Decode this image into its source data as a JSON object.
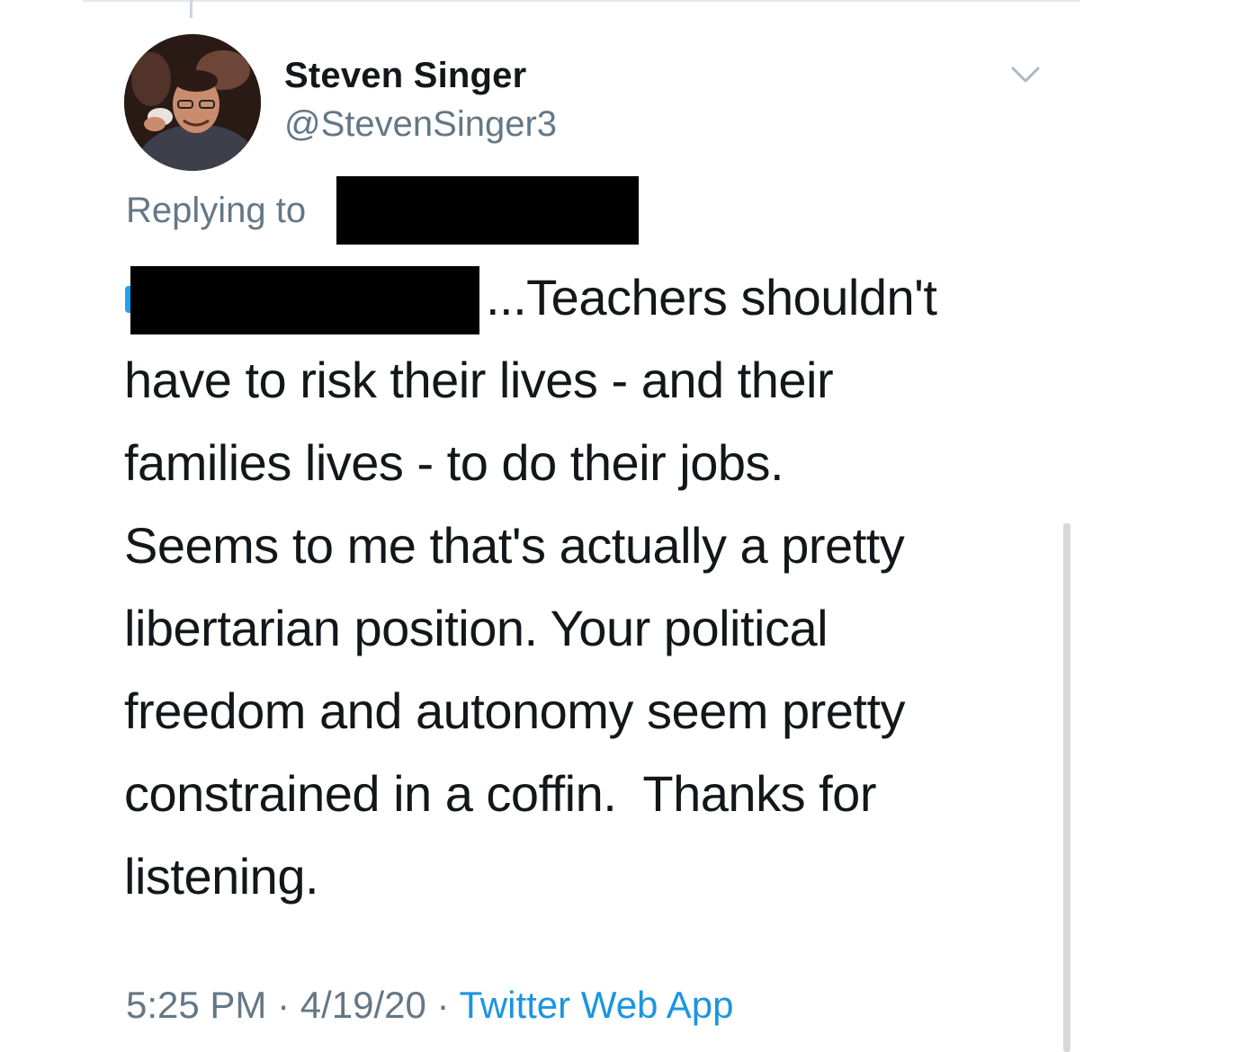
{
  "tweet": {
    "display_name": "Steven Singer",
    "handle": "@StevenSinger3",
    "replying_to_label": "Replying to",
    "text_lines": [
      "...Teachers shouldn't",
      "have to risk their lives - and their",
      "families lives - to do their jobs.",
      "Seems to me that's actually a pretty",
      "libertarian position. Your political",
      "freedom and autonomy seem pretty",
      "constrained in a coffin.  Thanks for",
      "listening."
    ],
    "time": "5:25 PM",
    "separator": " · ",
    "date": "4/19/20",
    "source": "Twitter Web App"
  },
  "colors": {
    "text": "#14171a",
    "secondary": "#657786",
    "link": "#1b95e0",
    "redaction": "#000000"
  },
  "icons": {
    "menu": "chevron-down-icon",
    "avatar": "profile-photo"
  }
}
